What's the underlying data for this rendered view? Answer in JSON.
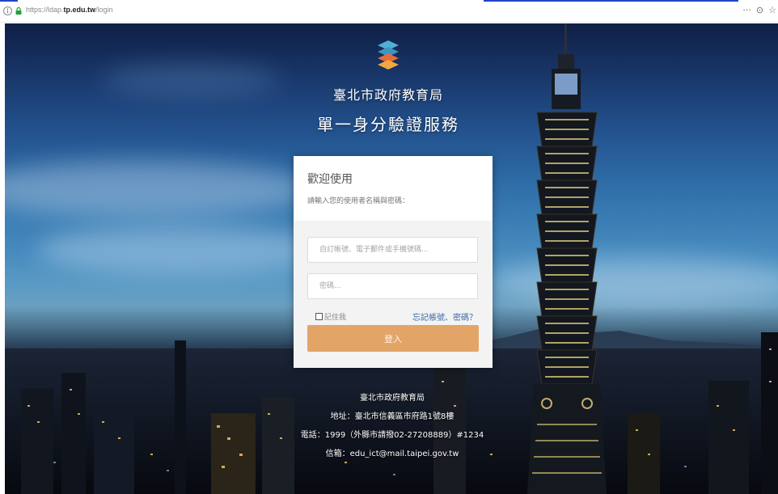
{
  "browser": {
    "url_prefix": "https://ldap.",
    "url_domain": "tp.edu.tw",
    "url_path": "/login",
    "info_glyph": "i",
    "right_icons": [
      "more-icon",
      "pocket-icon",
      "star-icon"
    ],
    "more_glyph": "···",
    "pocket_glyph": "⊙",
    "star_glyph": "☆"
  },
  "header": {
    "org_name": "臺北市政府教育局",
    "service_name": "單一身分驗證服務",
    "logo_colors": [
      "#4db0d8",
      "#e66b3a",
      "#f0a840"
    ]
  },
  "login": {
    "welcome": "歡迎使用",
    "prompt": "請輸入您的使用者名稱與密碼：",
    "account_placeholder": "自訂帳號、電子郵件或手機號碼...",
    "password_placeholder": "密碼...",
    "remember_label": "記住我",
    "forgot_label": "忘記帳號、密碼？",
    "login_button": "登入",
    "accent_color": "#e3a468"
  },
  "footer": {
    "line1": "臺北市政府教育局",
    "line2": "地址：臺北市信義區市府路1號8樓",
    "line3": "電話：1999（外縣市請撥02-27208889）#1234",
    "line4": "信箱：edu_ict@mail.taipei.gov.tw"
  }
}
